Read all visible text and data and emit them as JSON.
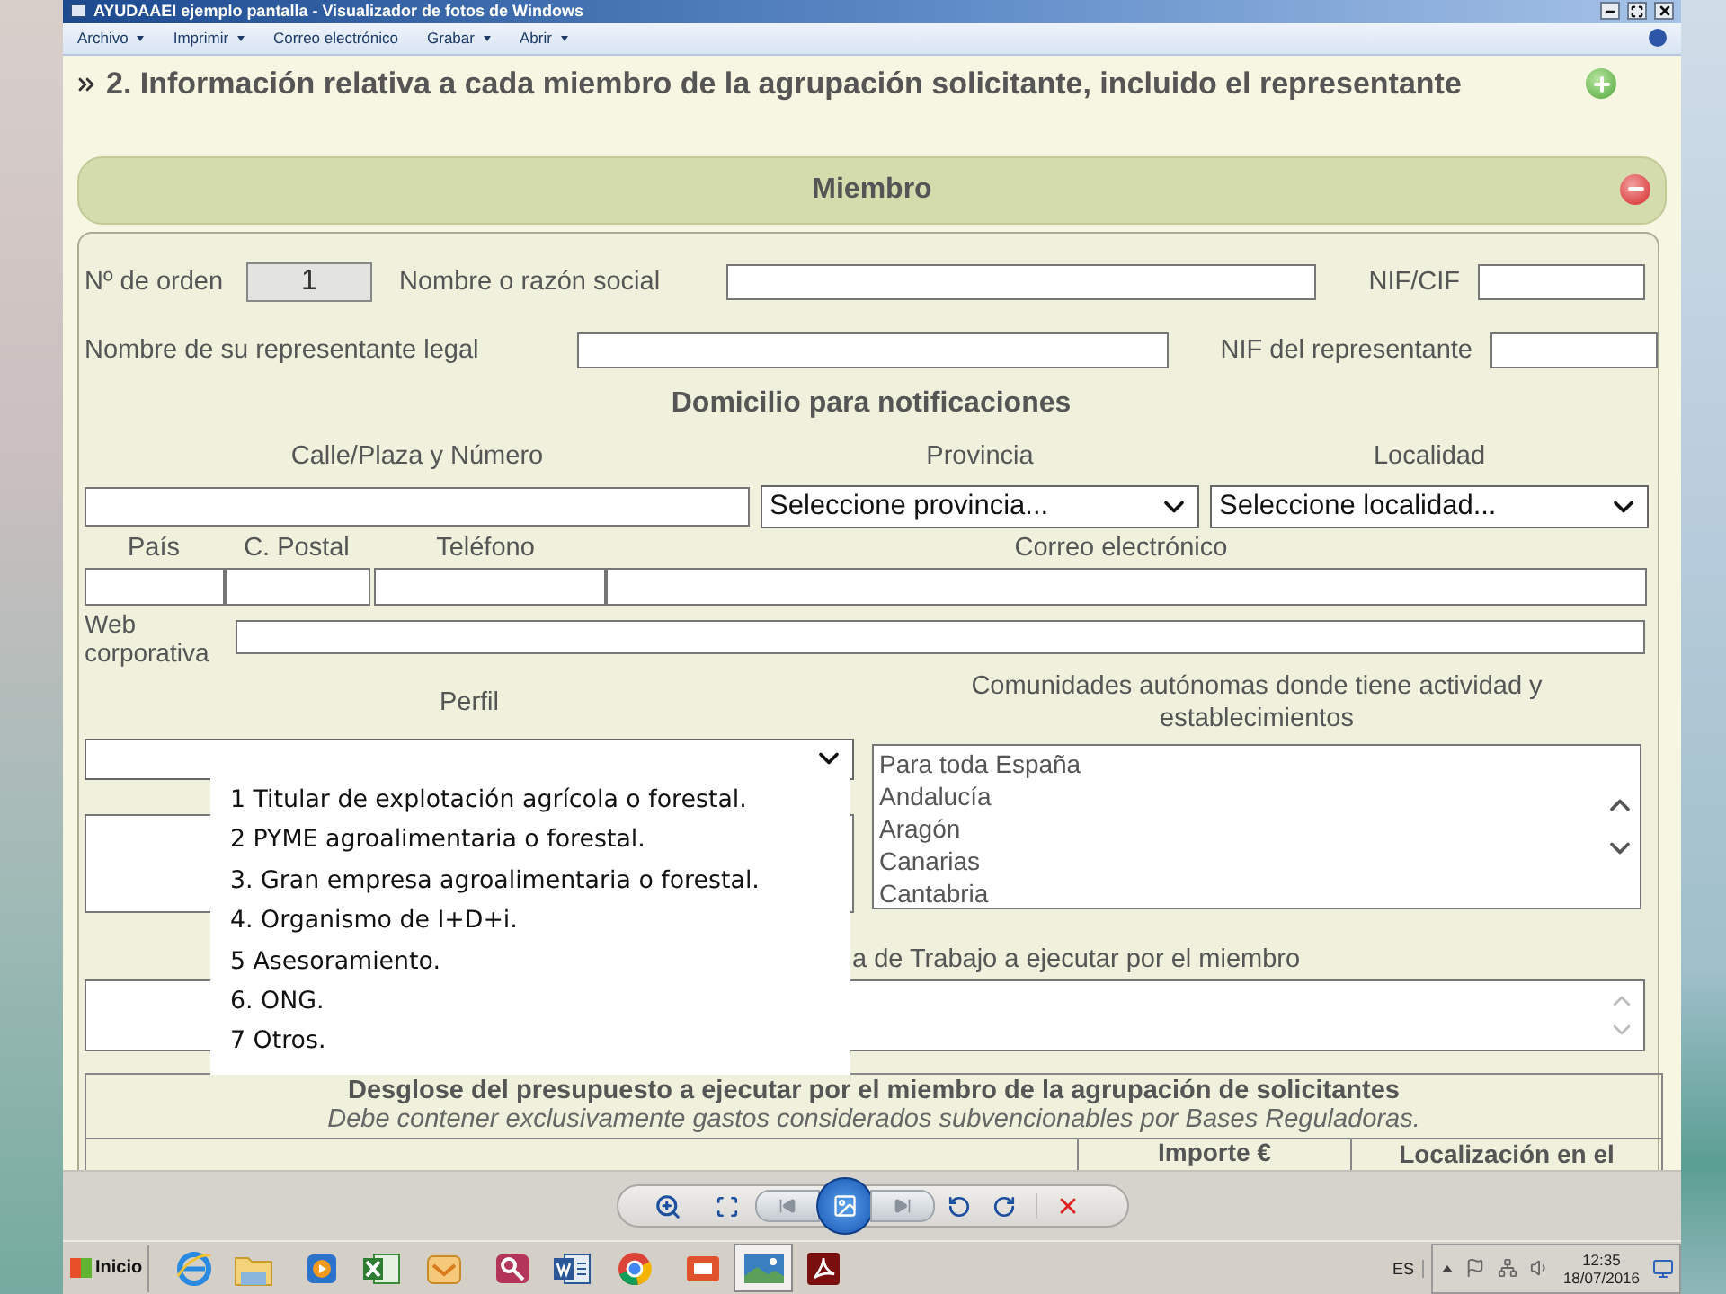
{
  "window": {
    "title": "AYUDAAEI ejemplo pantalla - Visualizador de fotos de Windows"
  },
  "menu": [
    {
      "label": "Archivo",
      "dropdown": true
    },
    {
      "label": "Imprimir",
      "dropdown": true
    },
    {
      "label": "Correo electrónico",
      "dropdown": false
    },
    {
      "label": "Grabar",
      "dropdown": true
    },
    {
      "label": "Abrir",
      "dropdown": true
    }
  ],
  "section": {
    "title": "2. Información relativa a cada miembro de la agrupación solicitante, incluido el representante"
  },
  "member": {
    "title": "Miembro"
  },
  "form": {
    "order_label": "Nº de orden",
    "order_value": "1",
    "name_label": "Nombre o razón social",
    "nif_label": "NIF/CIF",
    "rep_label": "Nombre de su representante legal",
    "rep_nif_label": "NIF del representante",
    "address_title": "Domicilio para notificaciones",
    "street_label": "Calle/Plaza y Número",
    "province_label": "Provincia",
    "locality_label": "Localidad",
    "province_value": "Seleccione provincia...",
    "locality_value": "Seleccione localidad...",
    "country_label": "País",
    "postal_label": "C. Postal",
    "phone_label": "Teléfono",
    "email_label": "Correo electrónico",
    "web_label": "Web corporativa",
    "profile_label": "Perfil",
    "regions_label": "Comunidades autónomas donde tiene actividad y establecimientos",
    "regions": [
      {
        "label": "Para toda España",
        "selected": false
      },
      {
        "label": "Andalucía",
        "selected": false
      },
      {
        "label": "Aragón",
        "selected": false
      },
      {
        "label": "Canarias",
        "selected": false
      },
      {
        "label": "Cantabria",
        "selected": false
      }
    ],
    "work_label": "a de Trabajo a ejecutar por el miembro",
    "budget_title": "Desglose del presupuesto a ejecutar por el miembro de la agrupación de solicitantes",
    "budget_note": "Debe contener exclusivamente gastos considerados subvencionables por Bases Reguladoras.",
    "budget_columns": [
      "Importe €",
      "Localización en el"
    ]
  },
  "profile_options": [
    "1 Titular de explotación agrícola o forestal.",
    "2 PYME agroalimentaria o forestal.",
    "3. Gran empresa agroalimentaria o forestal.",
    "4. Organismo de I+D+i.",
    "5 Asesoramiento.",
    "6. ONG.",
    "7 Otros."
  ],
  "taskbar": {
    "start": "Inicio",
    "language": "ES",
    "time": "12:35",
    "date": "18/07/2016",
    "apps": [
      {
        "kind": "browser",
        "selected": false
      },
      {
        "kind": "folder",
        "selected": false
      },
      {
        "kind": "media",
        "selected": false
      },
      {
        "kind": "spreadsheet",
        "selected": false
      },
      {
        "kind": "mail",
        "selected": false
      },
      {
        "kind": "database",
        "selected": false
      },
      {
        "kind": "document",
        "selected": false
      },
      {
        "kind": "chrome",
        "selected": false
      },
      {
        "kind": "presentation",
        "selected": false
      },
      {
        "kind": "photos",
        "selected": true
      },
      {
        "kind": "pdf",
        "selected": false
      }
    ]
  }
}
